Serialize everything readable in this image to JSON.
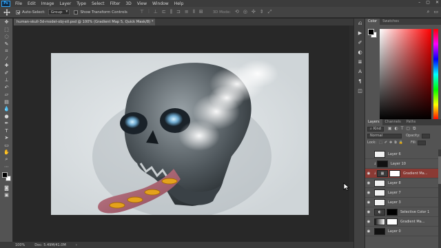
{
  "app": {
    "logo": "Ps",
    "menu": [
      "File",
      "Edit",
      "Image",
      "Layer",
      "Type",
      "Select",
      "Filter",
      "3D",
      "View",
      "Window",
      "Help"
    ],
    "window_controls": [
      "–",
      "▢",
      "✕"
    ]
  },
  "options": {
    "auto_select_label": "Auto-Select:",
    "auto_select_checked": true,
    "auto_select_value": "Group",
    "show_transform_label": "Show Transform Controls",
    "mode3d_label": "3D Mode:"
  },
  "document": {
    "tab_title": "human-skull-3d-model-obj-stl.psd @ 100% (Gradient Map 5, Quick Mask/8) *",
    "close": "×"
  },
  "status": {
    "zoom": "100%",
    "doc_info": "Doc: 5.49M/41.0M",
    "arrow": "›"
  },
  "panels": {
    "color_tab": "Color",
    "swatches_tab": "Swatches",
    "layers_tab": "Layers",
    "channels_tab": "Channels",
    "paths_tab": "Paths",
    "kind_label": "Kind",
    "blend_mode": "Normal",
    "opacity_label": "Opacity:",
    "lock_label": "Lock:",
    "fill_label": "Fill:"
  },
  "layers": [
    {
      "name": "Layer 6",
      "thumb": "light",
      "mask": "",
      "visible": false,
      "selected": false,
      "clipped": false
    },
    {
      "name": "Layer 10",
      "thumb": "dark",
      "mask": "",
      "visible": false,
      "selected": false,
      "clipped": false
    },
    {
      "name": "Gradient Ma...",
      "thumb": "adj",
      "mask": "white",
      "visible": true,
      "selected": true,
      "clipped": true
    },
    {
      "name": "Layer 8",
      "thumb": "light",
      "mask": "",
      "visible": true,
      "selected": false,
      "clipped": false
    },
    {
      "name": "Layer 7",
      "thumb": "light",
      "mask": "",
      "visible": true,
      "selected": false,
      "clipped": false
    },
    {
      "name": "Layer 3",
      "thumb": "light",
      "mask": "",
      "visible": true,
      "selected": false,
      "clipped": false
    },
    {
      "name": "Selective Color 1",
      "thumb": "adj",
      "mask": "black",
      "visible": true,
      "selected": false,
      "clipped": false
    },
    {
      "name": "Gradient Ma...",
      "thumb": "grad",
      "mask": "white",
      "visible": true,
      "selected": false,
      "clipped": false
    },
    {
      "name": "Layer 0",
      "thumb": "dark",
      "mask": "",
      "visible": true,
      "selected": false,
      "clipped": false
    }
  ],
  "colors": {
    "accent": "#31a8ff",
    "selected_layer": "#8a3a34",
    "tongue": "#b36a78",
    "coin": "#e4a21c"
  }
}
